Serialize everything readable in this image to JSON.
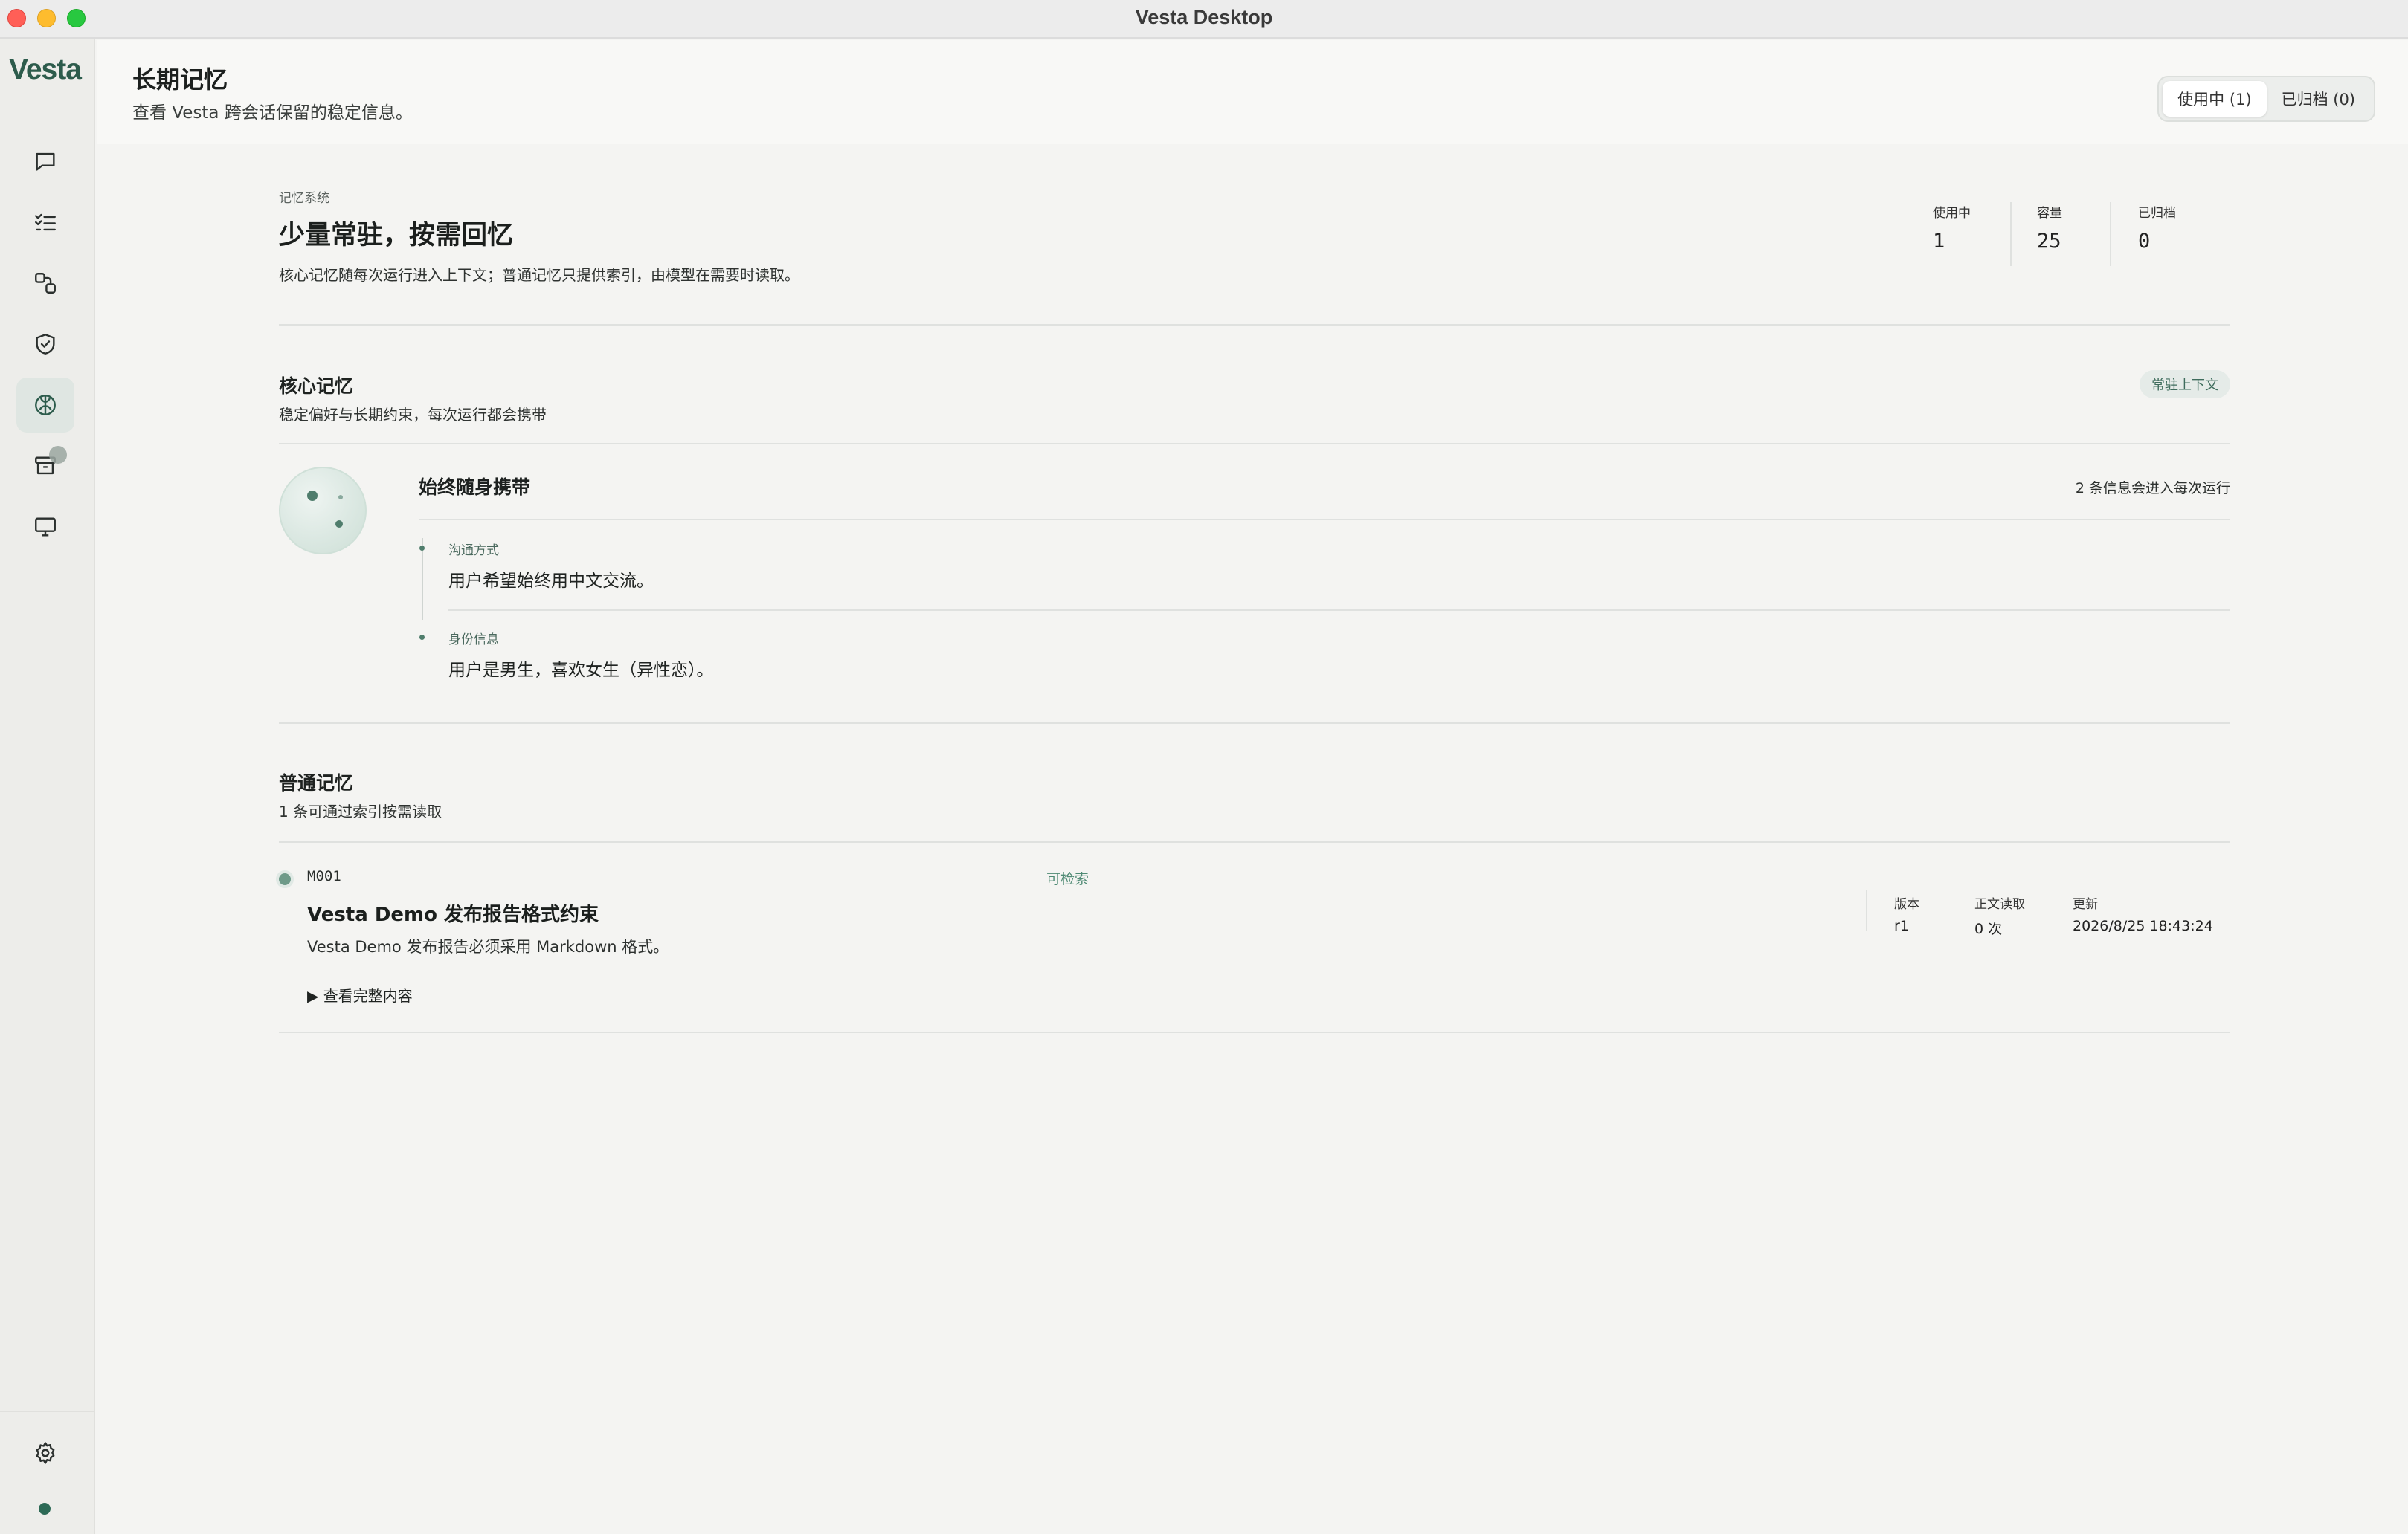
{
  "window": {
    "title": "Vesta Desktop"
  },
  "sidebar": {
    "brand": "Vesta",
    "items": [
      {
        "icon": "chat-bubble-icon"
      },
      {
        "icon": "checklist-icon"
      },
      {
        "icon": "workflow-icon"
      },
      {
        "icon": "shield-check-icon"
      },
      {
        "icon": "brain-icon",
        "active": true
      },
      {
        "icon": "archive-box-icon"
      },
      {
        "icon": "monitor-icon"
      }
    ],
    "settings_icon": "gear-icon"
  },
  "header": {
    "title": "长期记忆",
    "subtitle": "查看 Vesta 跨会话保留的稳定信息。",
    "tabs": [
      {
        "label": "使用中 (1)",
        "active": true
      },
      {
        "label": "已归档 (0)",
        "active": false
      }
    ]
  },
  "overview": {
    "eyebrow": "记忆系统",
    "title": "少量常驻，按需回忆",
    "description": "核心记忆随每次运行进入上下文；普通记忆只提供索引，由模型在需要时读取。",
    "stats": [
      {
        "label": "使用中",
        "value": "1"
      },
      {
        "label": "容量",
        "value": "25"
      },
      {
        "label": "已归档",
        "value": "0"
      }
    ]
  },
  "core": {
    "title": "核心记忆",
    "subtitle": "稳定偏好与长期约束，每次运行都会携带",
    "badge": "常驻上下文",
    "card_title": "始终随身携带",
    "card_meta": "2 条信息会进入每次运行",
    "entries": [
      {
        "label": "沟通方式",
        "text": "用户希望始终用中文交流。"
      },
      {
        "label": "身份信息",
        "text": "用户是男生，喜欢女生（异性恋）。"
      }
    ]
  },
  "regular": {
    "title": "普通记忆",
    "subtitle": "1 条可通过索引按需读取",
    "items": [
      {
        "id": "M001",
        "badge": "可检索",
        "title": "Vesta Demo 发布报告格式约束",
        "description": "Vesta Demo 发布报告必须采用 Markdown 格式。",
        "toggle": "▶ 查看完整内容",
        "meta": [
          {
            "label": "版本",
            "value": "r1"
          },
          {
            "label": "正文读取",
            "value": "0 次"
          },
          {
            "label": "更新",
            "value": "2026/8/25 18:43:24"
          }
        ]
      }
    ]
  },
  "colors": {
    "accent": "#2d5c4c",
    "badge_bg": "#e5ebe8",
    "badge_text": "#3e6c5c",
    "status": "#2d6a56"
  }
}
